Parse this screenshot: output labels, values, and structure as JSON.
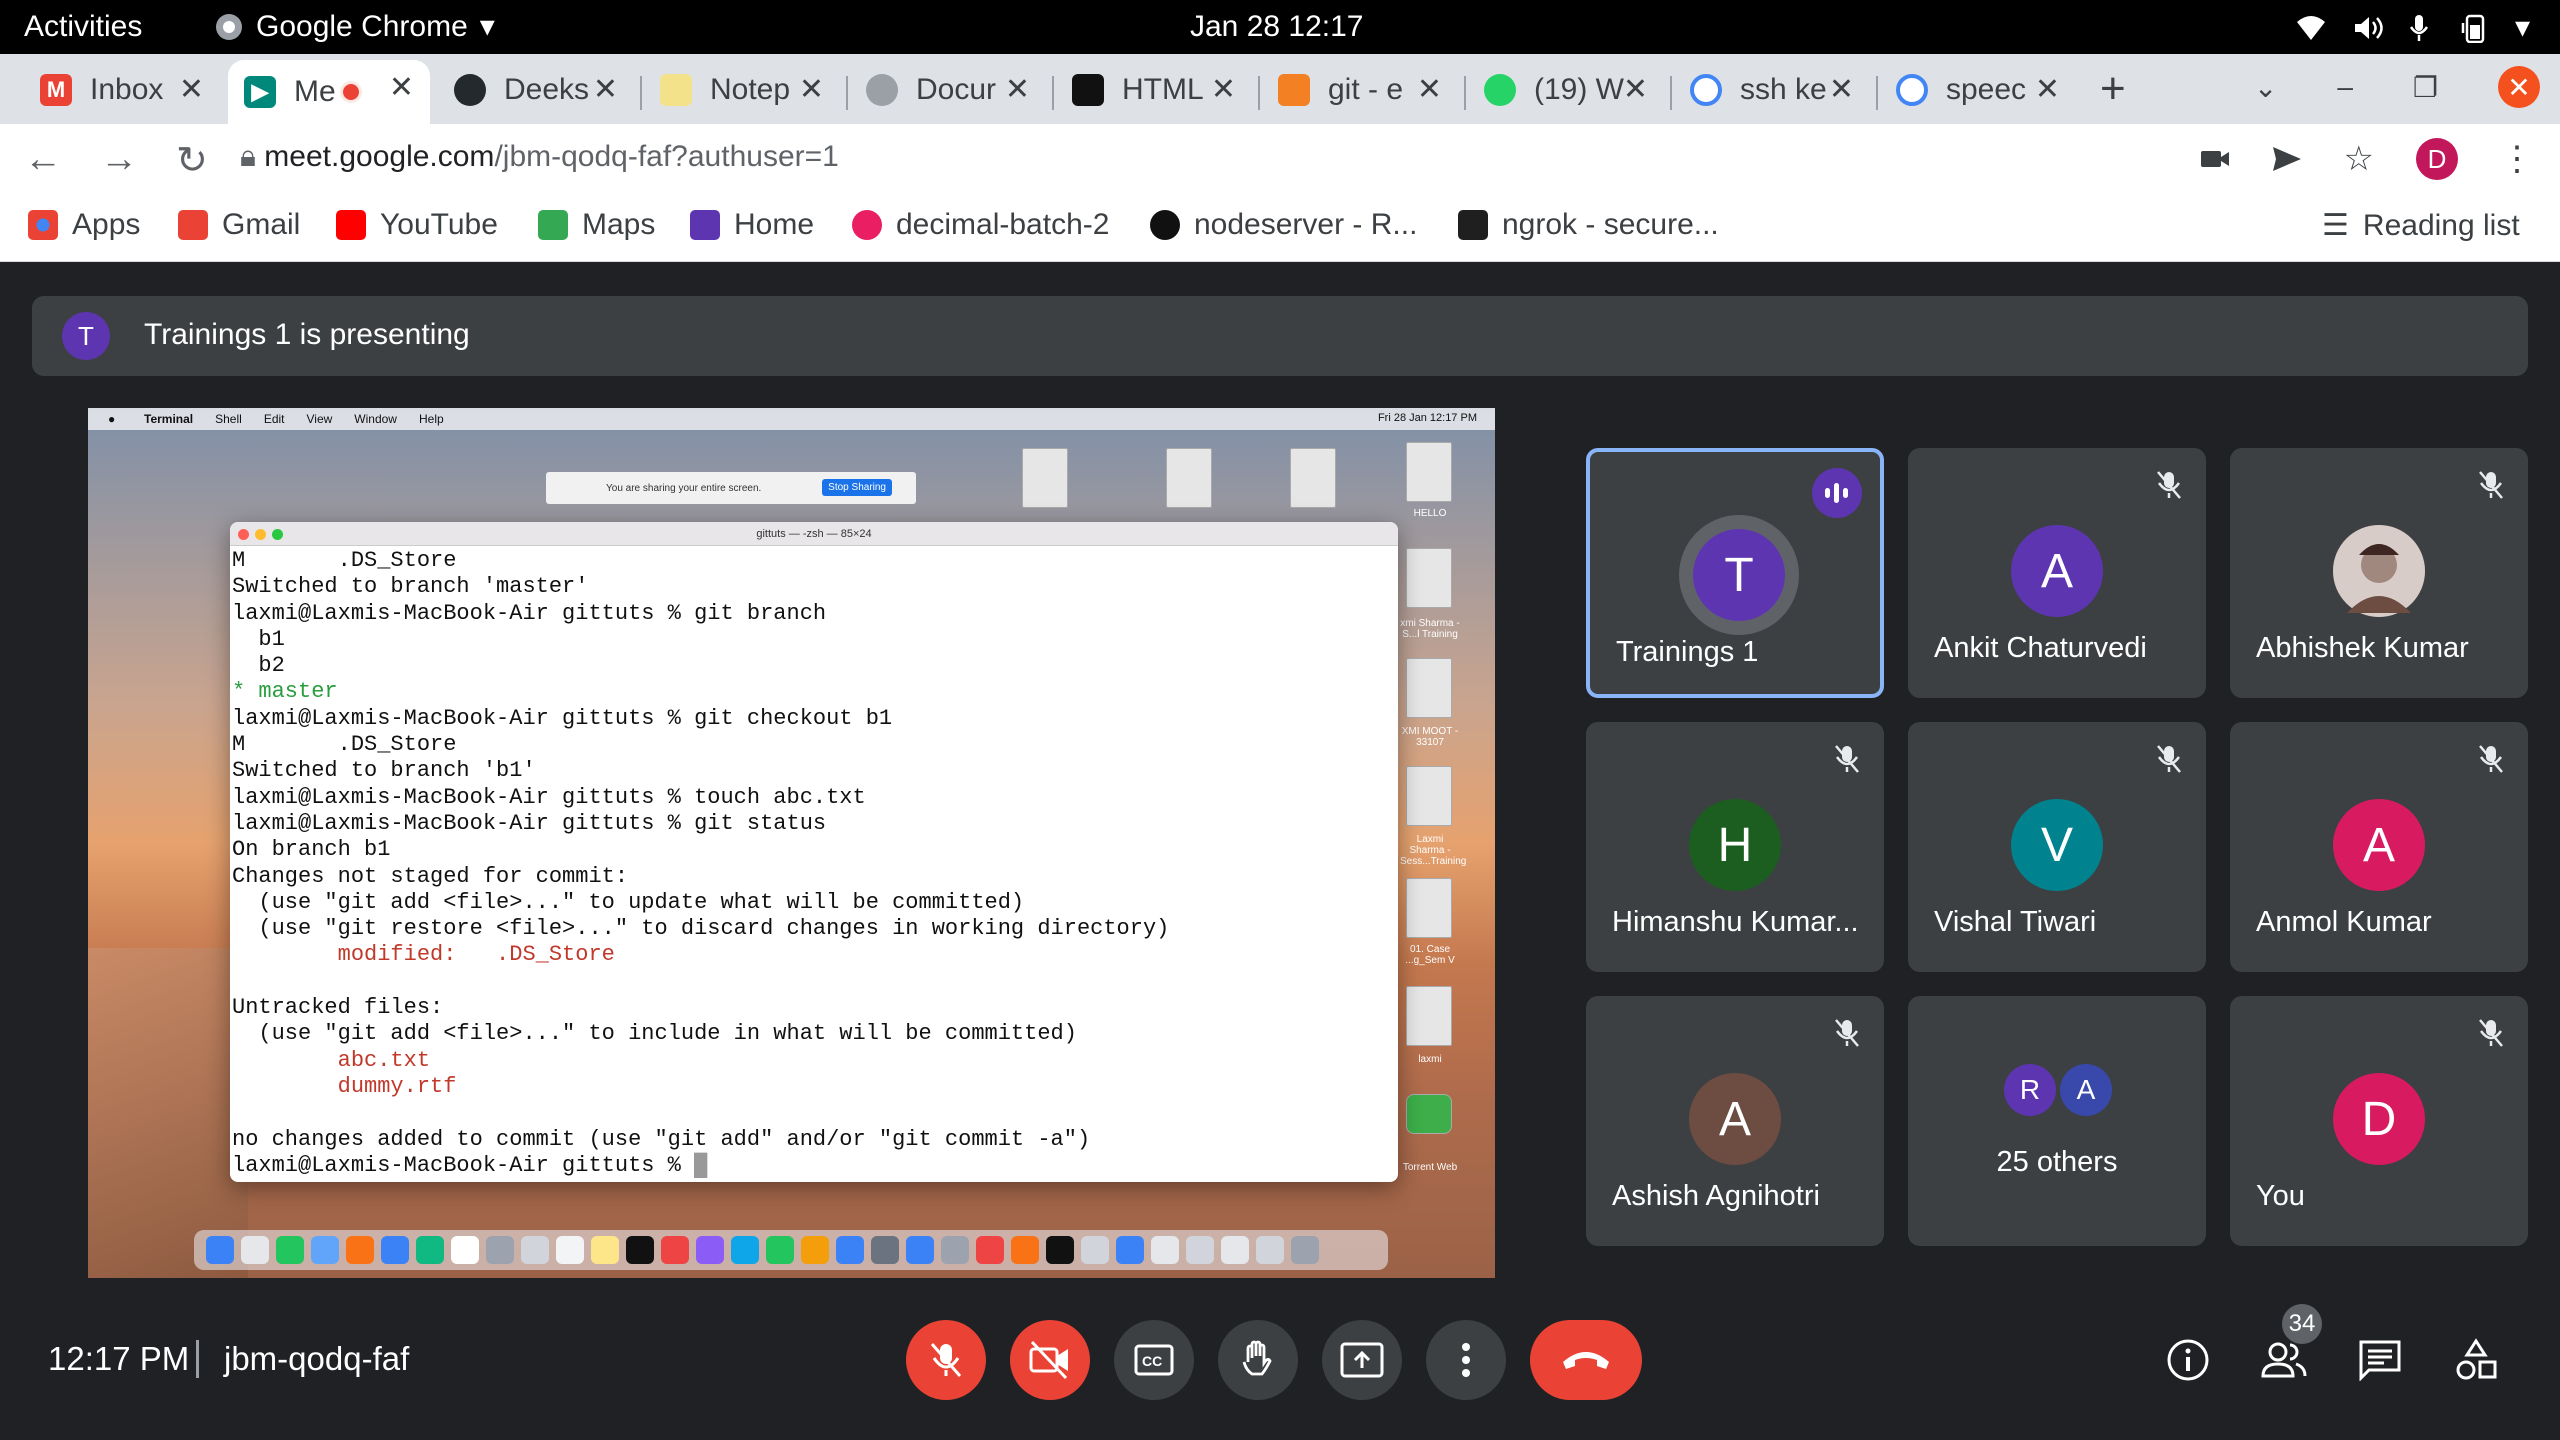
{
  "gnome": {
    "activities": "Activities",
    "app": "Google Chrome",
    "datetime": "Jan 28  12:17"
  },
  "tabs": [
    {
      "title": "Inbox",
      "color": "#ea4335",
      "icon": "gmail-icon"
    },
    {
      "title": "Me",
      "color": "#00897b",
      "icon": "meet-icon"
    },
    {
      "title": "Deeks",
      "color": "#24292e",
      "icon": "github-icon"
    },
    {
      "title": "Notep",
      "color": "#f4e28a",
      "icon": "notepad-icon"
    },
    {
      "title": "Docur",
      "color": "#9aa0a6",
      "icon": "globe-icon"
    },
    {
      "title": "HTML",
      "color": "#111111",
      "icon": "html-icon"
    },
    {
      "title": "git - e",
      "color": "#f48024",
      "icon": "stackoverflow-icon"
    },
    {
      "title": "(19) W",
      "color": "#25d366",
      "icon": "whatsapp-icon"
    },
    {
      "title": "ssh ke",
      "color": "#4285f4",
      "icon": "google-icon"
    },
    {
      "title": "speec",
      "color": "#4285f4",
      "icon": "google-icon"
    }
  ],
  "toolbar": {
    "url_host": "meet.google.com",
    "url_path": "/jbm-qodq-faf?authuser=1",
    "profile": "D"
  },
  "bookmarks": [
    {
      "label": "Apps",
      "color": "#4285f4"
    },
    {
      "label": "Gmail",
      "color": "#ea4335"
    },
    {
      "label": "YouTube",
      "color": "#ff0000"
    },
    {
      "label": "Maps",
      "color": "#34a853"
    },
    {
      "label": "Home",
      "color": "#5e35b1"
    },
    {
      "label": "decimal-batch-2",
      "color": "#e91e63"
    },
    {
      "label": "nodeserver - R...",
      "color": "#111111"
    },
    {
      "label": "ngrok - secure...",
      "color": "#1f1f1f"
    }
  ],
  "reading_list": "Reading list",
  "banner": {
    "avatar": "T",
    "text": "Trainings 1 is presenting"
  },
  "shared": {
    "menubar": [
      "Terminal",
      "Shell",
      "Edit",
      "View",
      "Window",
      "Help"
    ],
    "menubar_right": "Fri 28 Jan  12:17 PM",
    "share_text": "You are sharing your entire screen.",
    "stop": "Stop Sharing",
    "term_title": "gittuts — -zsh — 85×24",
    "desktop_labels": [
      "HELLO",
      "xmi Sharma - S...l Training",
      "XMI MOOT - 33107",
      "Laxmi Sharma - Sess...Training",
      "01. Case ...g_Sem V",
      "laxmi",
      "Torrent Web"
    ],
    "lines": [
      "M       .DS_Store",
      "Switched to branch 'master'",
      "laxmi@Laxmis-MacBook-Air gittuts % git branch",
      "  b1",
      "  b2",
      "* master",
      "laxmi@Laxmis-MacBook-Air gittuts % git checkout b1",
      "M       .DS_Store",
      "Switched to branch 'b1'",
      "laxmi@Laxmis-MacBook-Air gittuts % touch abc.txt",
      "laxmi@Laxmis-MacBook-Air gittuts % git status",
      "On branch b1",
      "Changes not staged for commit:",
      "  (use \"git add <file>...\" to update what will be committed)",
      "  (use \"git restore <file>...\" to discard changes in working directory)",
      "        modified:   .DS_Store",
      "",
      "Untracked files:",
      "  (use \"git add <file>...\" to include in what will be committed)",
      "        abc.txt",
      "        dummy.rtf",
      "",
      "no changes added to commit (use \"git add\" and/or \"git commit -a\")",
      "laxmi@Laxmis-MacBook-Air gittuts % "
    ],
    "line_colors": [
      "",
      "",
      "",
      "",
      "",
      "g",
      "",
      "",
      "",
      "",
      "",
      "",
      "",
      "",
      "",
      "r",
      "",
      "",
      "",
      "r",
      "r",
      "",
      "",
      ""
    ]
  },
  "participants": [
    {
      "name": "Trainings 1",
      "initial": "T",
      "color": "#5e35b1",
      "speaking": true
    },
    {
      "name": "Ankit Chaturvedi",
      "initial": "A",
      "color": "#5e35b1",
      "muted": true
    },
    {
      "name": "Abhishek Kumar",
      "initial": "",
      "color": "#8d6e63",
      "muted": true,
      "photo": true
    },
    {
      "name": "Himanshu Kumar...",
      "initial": "H",
      "color": "#1b5e20",
      "muted": true
    },
    {
      "name": "Vishal Tiwari",
      "initial": "V",
      "color": "#00838f",
      "muted": true
    },
    {
      "name": "Anmol Kumar",
      "initial": "A",
      "color": "#d81b60",
      "muted": true
    },
    {
      "name": "Ashish Agnihotri",
      "initial": "A",
      "color": "#6d4c41",
      "muted": true
    },
    {
      "name": "25 others",
      "others": [
        "R",
        "A"
      ],
      "other_colors": [
        "#5e35b1",
        "#3949ab"
      ]
    },
    {
      "name": "You",
      "initial": "D",
      "color": "#d81b60",
      "muted": true
    }
  ],
  "bottom": {
    "time": "12:17 PM",
    "code": "jbm-qodq-faf",
    "people_count": "34"
  }
}
